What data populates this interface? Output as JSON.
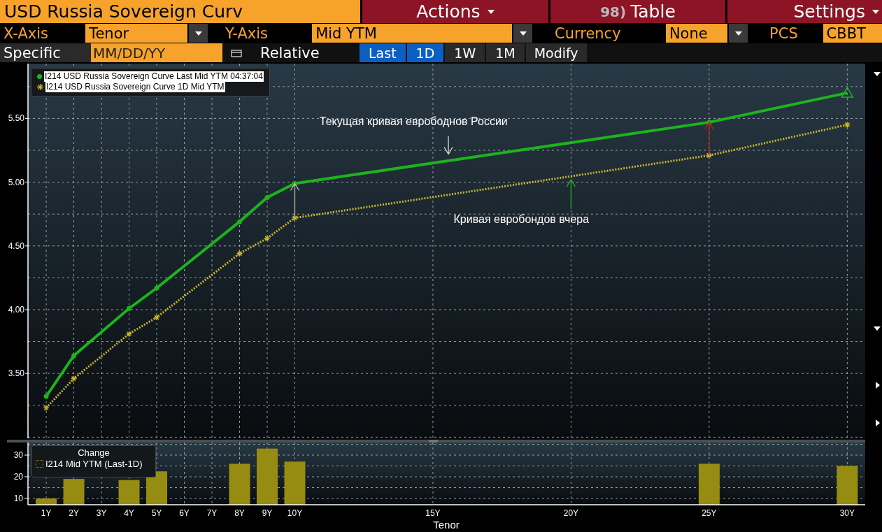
{
  "toolbar": {
    "title": "USD Russia Sovereign Curv",
    "menus": [
      {
        "label": "Actions",
        "caret": true
      },
      {
        "number": "98)",
        "label": "Table",
        "caret": false
      },
      {
        "label": "Settings",
        "caret": true
      }
    ]
  },
  "axis_controls": [
    {
      "label": "X-Axis",
      "value": "Tenor",
      "dropdown": true
    },
    {
      "label": "Y-Axis",
      "value": "Mid YTM",
      "dropdown": true
    },
    {
      "label": "Currency",
      "value": "None",
      "dropdown": true
    },
    {
      "label": "PCS",
      "value": "CBBT",
      "dropdown": false
    }
  ],
  "date_bar": {
    "label": "Specific",
    "placeholder": "MM/DD/YY",
    "relative_label": "Relative",
    "periods": [
      {
        "label": "Last",
        "selected": true
      },
      {
        "label": "1D",
        "selected": true
      },
      {
        "label": "1W",
        "selected": false
      },
      {
        "label": "1M",
        "selected": false
      }
    ],
    "modify": "Modify"
  },
  "main_chart": {
    "chart_data": {
      "type": "line",
      "x": [
        1,
        2,
        4,
        5,
        8,
        9,
        10,
        25,
        30
      ],
      "xlim": [
        0.34,
        30.65
      ],
      "ylim": [
        2.98,
        5.93
      ],
      "grid": true,
      "yticks": [
        {
          "value": 3.5,
          "label": "3.50"
        },
        {
          "value": 4,
          "label": "4.00"
        },
        {
          "value": 4.5,
          "label": "4.50"
        },
        {
          "value": 5,
          "label": "5.00"
        },
        {
          "value": 5.5,
          "label": "5.50"
        }
      ],
      "series": [
        {
          "name": "I214 USD Russia Sovereign Curve Last Mid YTM 04:37:04",
          "color": "#1db31d",
          "marker": "circle",
          "line_style": "solid",
          "values": [
            3.32,
            3.64,
            4.01,
            4.17,
            4.69,
            4.88,
            4.99,
            5.47,
            5.7
          ]
        },
        {
          "name": "I214 USD Russia Sovereign Curve 1D Mid YTM",
          "color": "#c9b52c",
          "marker": "cross",
          "line_style": "dotted",
          "values": [
            3.23,
            3.46,
            3.81,
            3.94,
            4.44,
            4.56,
            4.72,
            5.21,
            5.45
          ]
        }
      ],
      "annotations": [
        "Текущая кривая еврободнов России",
        "Кривая евробондов вчера"
      ]
    }
  },
  "change_chart": {
    "chart_data": {
      "type": "bar",
      "title": "Change",
      "xlabel": "Tenor",
      "x": [
        1,
        2,
        4,
        5,
        8,
        9,
        10,
        25,
        30
      ],
      "xlim": [
        0.34,
        30.65
      ],
      "ylim": [
        7.1,
        35.8
      ],
      "grid": true,
      "xticks": [
        {
          "value": 1,
          "label": "1Y"
        },
        {
          "value": 2,
          "label": "2Y"
        },
        {
          "value": 3,
          "label": "3Y"
        },
        {
          "value": 4,
          "label": "4Y"
        },
        {
          "value": 5,
          "label": "5Y"
        },
        {
          "value": 6,
          "label": "6Y"
        },
        {
          "value": 7,
          "label": "7Y"
        },
        {
          "value": 8,
          "label": "8Y"
        },
        {
          "value": 9,
          "label": "9Y"
        },
        {
          "value": 10,
          "label": "10Y"
        },
        {
          "value": 15,
          "label": "15Y"
        },
        {
          "value": 20,
          "label": "20Y"
        },
        {
          "value": 25,
          "label": "25Y"
        },
        {
          "value": 30,
          "label": "30Y"
        }
      ],
      "yticks": [
        10,
        20,
        30
      ],
      "series": [
        {
          "name": "I214 Mid YTM (Last-1D)",
          "color": "#978c12",
          "values": [
            10,
            19,
            18.5,
            22.5,
            26,
            33,
            27,
            26,
            25
          ]
        }
      ]
    }
  }
}
